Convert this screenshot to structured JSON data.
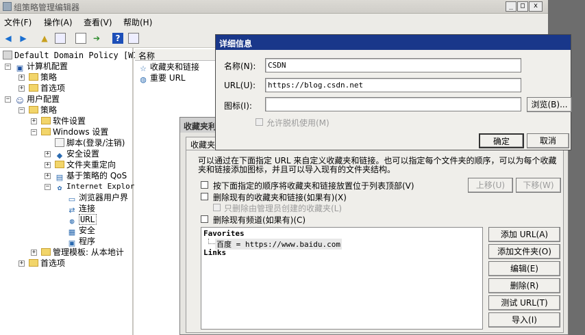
{
  "window": {
    "title": "组策略管理编辑器",
    "min": "_",
    "max": "□",
    "close": "x"
  },
  "menu": [
    "文件(F)",
    "操作(A)",
    "查看(V)",
    "帮助(H)"
  ],
  "tree": {
    "root": "Default Domain Policy [WIN-I",
    "computer_config": "计算机配置",
    "policies1": "策略",
    "preferences1": "首选项",
    "user_config": "用户配置",
    "policies2": "策略",
    "software_settings": "软件设置",
    "windows_settings": "Windows 设置",
    "scripts": "脚本(登录/注销)",
    "security_settings": "安全设置",
    "folder_redirection": "文件夹重定向",
    "qos": "基于策略的 QoS",
    "ie_maintenance": "Internet Explor",
    "browser_ui": "浏览器用户界",
    "connection": "连接",
    "url": "URL",
    "security": "安全",
    "programs": "程序",
    "admin_templates": "管理模板: 从本地计",
    "preferences2": "首选项"
  },
  "list": {
    "column_name": "名称",
    "items": [
      "收藏夹和链接",
      "重要 URL"
    ]
  },
  "favorites_dialog": {
    "title": "收藏夹利",
    "tab": "收藏夹",
    "description": "可以通过在下面指定 URL 来自定义收藏夹和链接。也可以指定每个文件夹的顺序，可以为每个收藏夹和链接添加图标，并且可以导入现有的文件夹结构。",
    "opt_order": "按下面指定的顺序将收藏夹和链接放置位于列表顶部(V)",
    "opt_delete": "删除现有的收藏夹和链接(如果有)(X)",
    "opt_delete_admin": "只删除由管理员创建的收藏夹(L)",
    "opt_delete_channels": "删除现有频道(如果有)(C)",
    "move_up": "上移(U)",
    "move_down": "下移(W)",
    "tree_favorites": "Favorites",
    "tree_item": "百度 = https://www.baidu.com",
    "tree_links": "Links",
    "add_url": "添加 URL(A)",
    "add_folder": "添加文件夹(O)",
    "edit": "编辑(E)",
    "delete": "删除(R)",
    "test_url": "测试 URL(T)",
    "import": "导入(I)"
  },
  "details_dialog": {
    "title": "详细信息",
    "name_label": "名称(N):",
    "name_value": "CSDN",
    "url_label": "URL(U):",
    "url_value": "https://blog.csdn.net",
    "icon_label": "图标(I):",
    "icon_value": "",
    "browse": "浏览(B)...",
    "offline": "允许脱机使用(M)",
    "ok": "确定",
    "cancel": "取消"
  }
}
